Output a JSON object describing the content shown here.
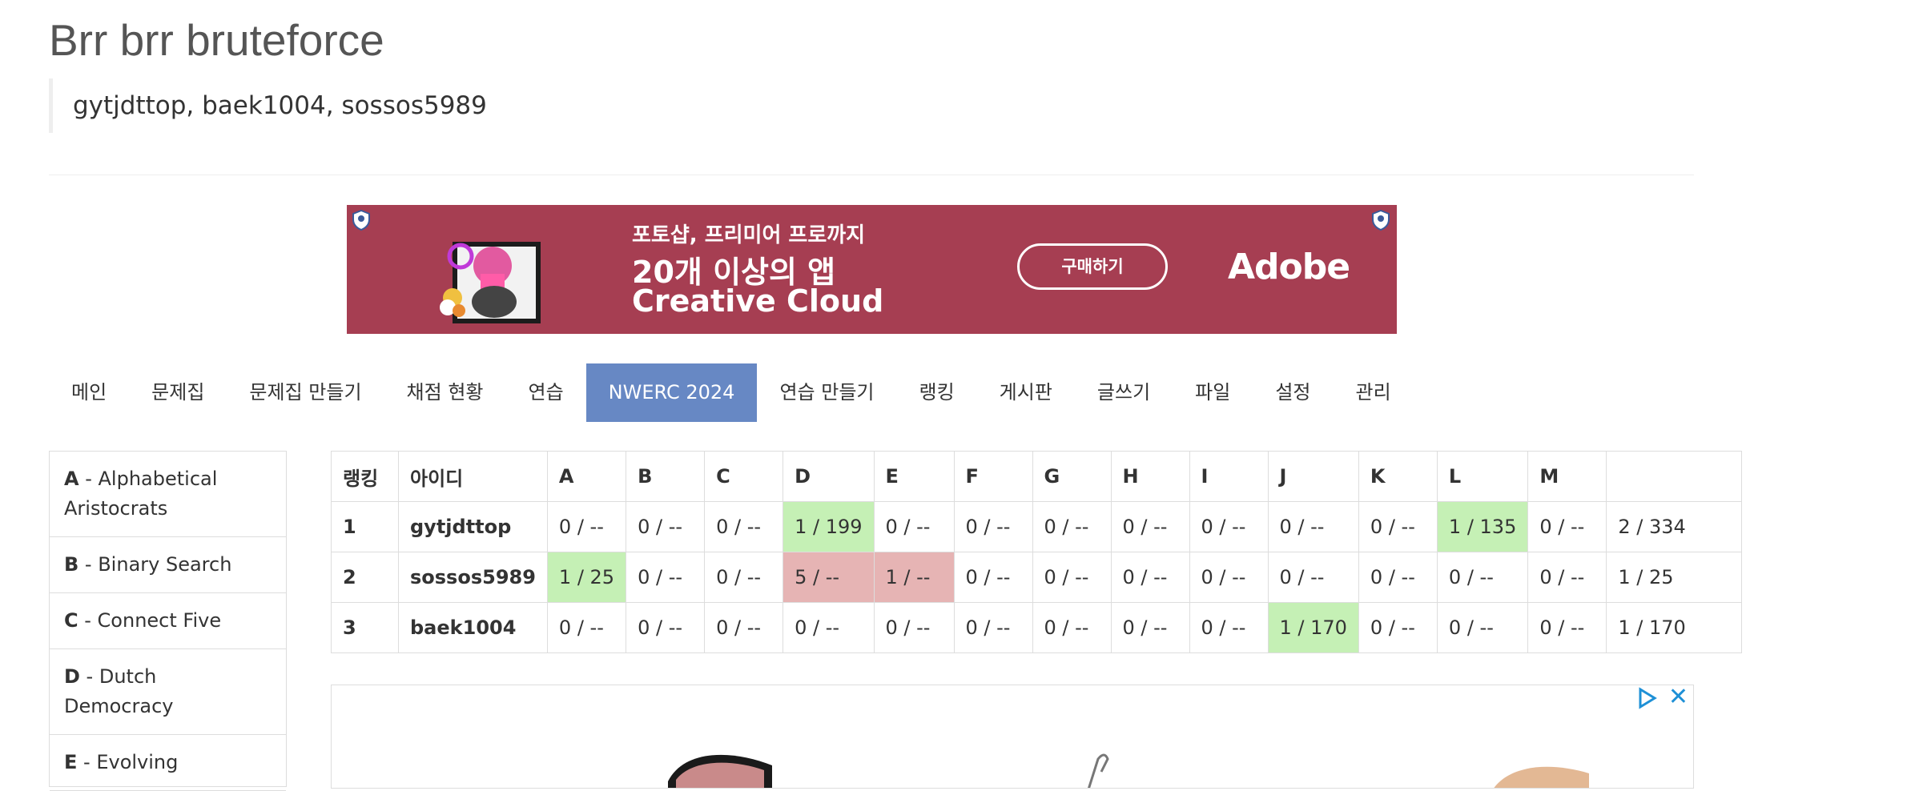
{
  "page": {
    "title": "Brr brr bruteforce",
    "members": "gytjdttop, baek1004, sossos5989"
  },
  "ad_banner": {
    "line1": "포토샵, 프리미어 프로까지",
    "line2": "20개 이상의 앱",
    "line3": "Creative Cloud",
    "button": "구매하기",
    "brand": "Adobe",
    "colors": {
      "background": "#a63e52"
    }
  },
  "nav": {
    "tabs": [
      {
        "label": "메인"
      },
      {
        "label": "문제집"
      },
      {
        "label": "문제집 만들기"
      },
      {
        "label": "채점 현황"
      },
      {
        "label": "연습"
      },
      {
        "label": "NWERC 2024",
        "active": true
      },
      {
        "label": "연습 만들기"
      },
      {
        "label": "랭킹"
      },
      {
        "label": "게시판"
      },
      {
        "label": "글쓰기"
      },
      {
        "label": "파일"
      },
      {
        "label": "설정"
      },
      {
        "label": "관리"
      }
    ],
    "active_color": "#6788c4"
  },
  "problems": [
    {
      "letter": "A",
      "name": "Alphabetical Aristocrats"
    },
    {
      "letter": "B",
      "name": "Binary Search"
    },
    {
      "letter": "C",
      "name": "Connect Five"
    },
    {
      "letter": "D",
      "name": "Dutch Democracy"
    },
    {
      "letter": "E",
      "name": "Evolving"
    }
  ],
  "scoreboard": {
    "headers": [
      "랭킹",
      "아이디",
      "A",
      "B",
      "C",
      "D",
      "E",
      "F",
      "G",
      "H",
      "I",
      "J",
      "K",
      "L",
      "M",
      ""
    ],
    "rows": [
      {
        "rank": "1",
        "id": "gytjdttop",
        "cells": [
          "0 / --",
          "0 / --",
          "0 / --",
          "1 / 199",
          "0 / --",
          "0 / --",
          "0 / --",
          "0 / --",
          "0 / --",
          "0 / --",
          "0 / --",
          "1 / 135",
          "0 / --"
        ],
        "status": [
          "",
          "",
          "",
          "ok",
          "",
          "",
          "",
          "",
          "",
          "",
          "",
          "ok",
          ""
        ],
        "total": "2 / 334"
      },
      {
        "rank": "2",
        "id": "sossos5989",
        "cells": [
          "1 / 25",
          "0 / --",
          "0 / --",
          "5 / --",
          "1 / --",
          "0 / --",
          "0 / --",
          "0 / --",
          "0 / --",
          "0 / --",
          "0 / --",
          "0 / --",
          "0 / --"
        ],
        "status": [
          "ok",
          "",
          "",
          "bad",
          "bad",
          "",
          "",
          "",
          "",
          "",
          "",
          "",
          ""
        ],
        "total": "1 / 25"
      },
      {
        "rank": "3",
        "id": "baek1004",
        "cells": [
          "0 / --",
          "0 / --",
          "0 / --",
          "0 / --",
          "0 / --",
          "0 / --",
          "0 / --",
          "0 / --",
          "0 / --",
          "1 / 170",
          "0 / --",
          "0 / --",
          "0 / --"
        ],
        "status": [
          "",
          "",
          "",
          "",
          "",
          "",
          "",
          "",
          "",
          "ok",
          "",
          "",
          ""
        ],
        "total": "1 / 170"
      }
    ],
    "colors": {
      "solved": "#c5f0b5",
      "wrong": "#e6b4b4"
    }
  },
  "ad_bottom": {
    "close_icon": "close-icon",
    "adchoices_icon": "adchoices-icon"
  }
}
